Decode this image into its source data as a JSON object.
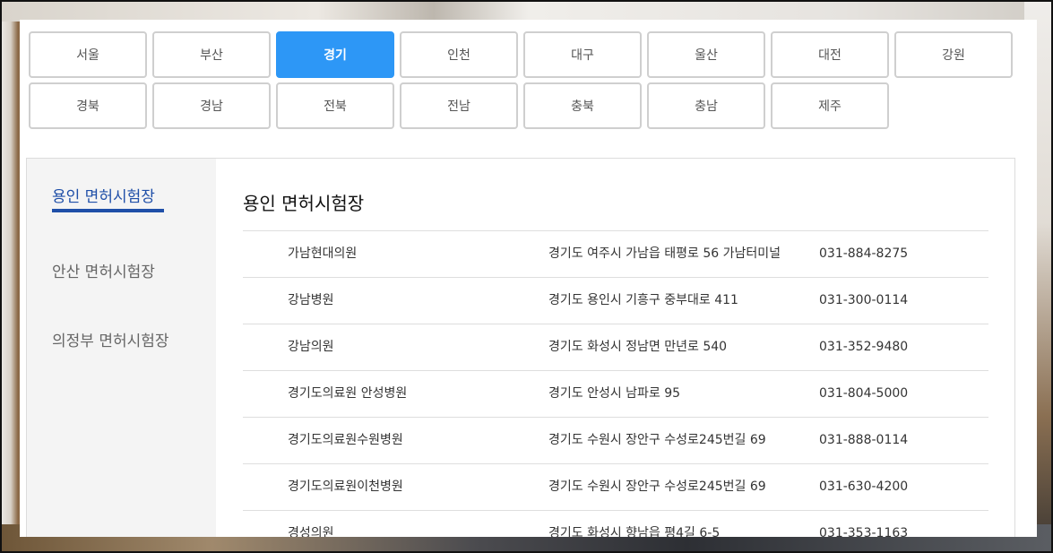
{
  "regions": [
    {
      "label": "서울",
      "active": false
    },
    {
      "label": "부산",
      "active": false
    },
    {
      "label": "경기",
      "active": true
    },
    {
      "label": "인천",
      "active": false
    },
    {
      "label": "대구",
      "active": false
    },
    {
      "label": "울산",
      "active": false
    },
    {
      "label": "대전",
      "active": false
    },
    {
      "label": "강원",
      "active": false
    },
    {
      "label": "경북",
      "active": false
    },
    {
      "label": "경남",
      "active": false
    },
    {
      "label": "전북",
      "active": false
    },
    {
      "label": "전남",
      "active": false
    },
    {
      "label": "충북",
      "active": false
    },
    {
      "label": "충남",
      "active": false
    },
    {
      "label": "제주",
      "active": false
    }
  ],
  "sidebar": {
    "items": [
      {
        "label": "용인 면허시험장",
        "active": true
      },
      {
        "label": "안산 면허시험장",
        "active": false
      },
      {
        "label": "의정부 면허시험장",
        "active": false
      }
    ]
  },
  "main": {
    "title": "용인 면허시험장",
    "rows": [
      {
        "name": "가남현대의원",
        "address": "경기도 여주시 가남읍 태평로 56 가남터미널",
        "phone": "031-884-8275"
      },
      {
        "name": "강남병원",
        "address": "경기도 용인시 기흥구 중부대로 411",
        "phone": "031-300-0114"
      },
      {
        "name": "강남의원",
        "address": "경기도 화성시 정남면 만년로 540",
        "phone": "031-352-9480"
      },
      {
        "name": "경기도의료원 안성병원",
        "address": "경기도 안성시 남파로 95",
        "phone": "031-804-5000"
      },
      {
        "name": "경기도의료원수원병원",
        "address": "경기도 수원시 장안구 수성로245번길 69",
        "phone": "031-888-0114"
      },
      {
        "name": "경기도의료원이천병원",
        "address": "경기도 수원시 장안구 수성로245번길 69",
        "phone": "031-630-4200"
      },
      {
        "name": "경성의원",
        "address": "경기도 화성시 향남읍 평4길 6-5",
        "phone": "031-353-1163"
      }
    ]
  }
}
